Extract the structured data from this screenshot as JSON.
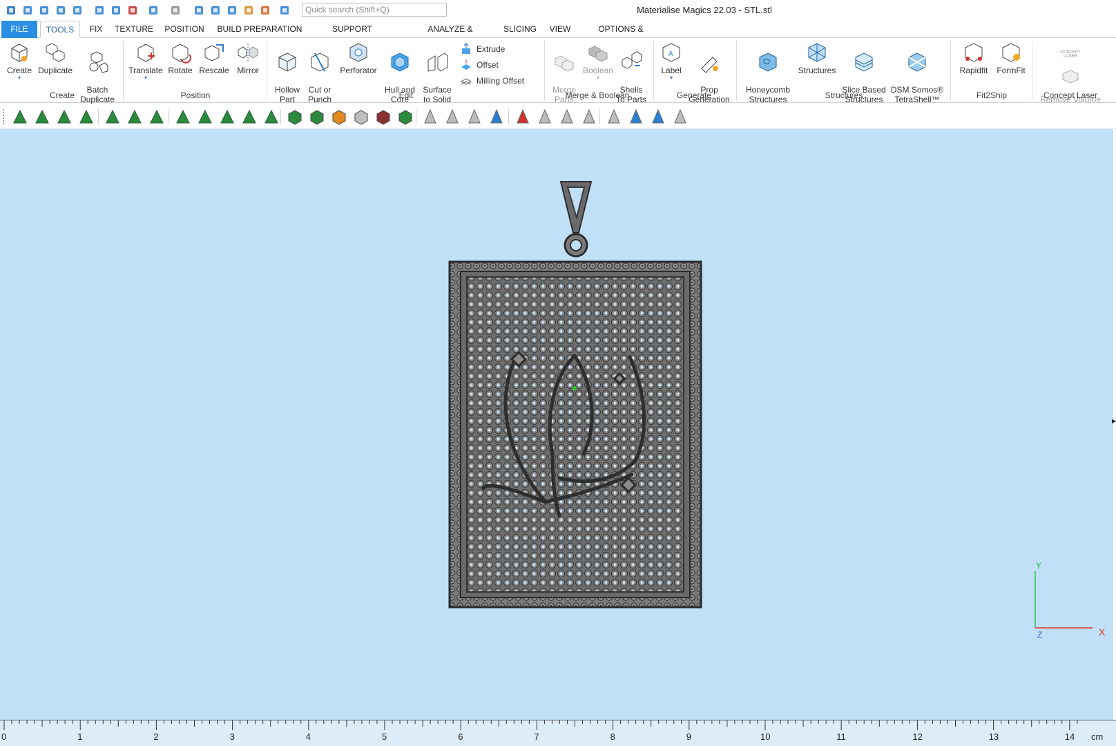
{
  "app": {
    "title": "Materialise Magics 22.03 - STL.stl",
    "search_placeholder": "Quick search (Shift+Q)"
  },
  "quick_access": [
    {
      "name": "app-logo-icon"
    },
    {
      "name": "new-icon"
    },
    {
      "name": "open-icon"
    },
    {
      "name": "save-icon"
    },
    {
      "name": "save-all-icon"
    },
    {
      "name": "import-icon"
    },
    {
      "name": "save-as-icon"
    },
    {
      "name": "close-part-icon"
    },
    {
      "name": "undo-icon"
    },
    {
      "name": "redo-icon"
    },
    {
      "name": "select-icon"
    },
    {
      "name": "zoom-region-icon"
    },
    {
      "name": "view-part-icon"
    },
    {
      "name": "zoom-icon"
    },
    {
      "name": "zoom-fit-icon"
    },
    {
      "name": "settings-icon"
    }
  ],
  "tabs": [
    "FILE",
    "TOOLS",
    "FIX",
    "TEXTURE",
    "POSITION",
    "BUILD PREPARATION",
    "SUPPORT GENERATION",
    "ANALYZE & REPORT",
    "SLICING",
    "VIEW",
    "OPTIONS & HELP"
  ],
  "active_tab": "TOOLS",
  "ribbon": {
    "create_group": {
      "label": "Create",
      "buttons": [
        "Create",
        "Duplicate",
        "Batch\nDuplicate"
      ]
    },
    "position_group": {
      "label": "Position",
      "buttons": [
        "Translate",
        "Rotate",
        "Rescale",
        "Mirror"
      ]
    },
    "edit_group": {
      "label": "Edit",
      "buttons": [
        "Hollow\nPart",
        "Cut or\nPunch",
        "Perforator",
        "Hull and\nCore",
        "Surface\nto Solid"
      ],
      "small": [
        "Extrude",
        "Offset",
        "Milling Offset"
      ]
    },
    "merge_group": {
      "label": "Merge & Boolean",
      "buttons": [
        "Merge\nParts",
        "Boolean",
        "Shells\nTo Parts"
      ]
    },
    "generate_group": {
      "label": "Generate",
      "buttons": [
        "Label",
        "Prop\nGeneration"
      ]
    },
    "structures_group": {
      "label": "Structures",
      "buttons": [
        "Honeycomb\nStructures",
        "Structures",
        "Slice Based\nStructures",
        "DSM Somos®\nTetraShell™"
      ]
    },
    "fit2ship_group": {
      "label": "Fit2Ship",
      "buttons": [
        "Rapidfit",
        "FormFit"
      ]
    },
    "concept_group": {
      "label": "Concept Laser",
      "buttons": [
        "Remove Volume\nWizard"
      ],
      "badge": "CONCEPT\nLASER"
    }
  },
  "axes": {
    "y": "Y",
    "x": "X",
    "z": "Z"
  },
  "ruler": {
    "unit": "cm",
    "labels": [
      "0",
      "1",
      "2",
      "3",
      "4",
      "5",
      "6",
      "7",
      "8",
      "9",
      "10",
      "11",
      "12",
      "13",
      "14"
    ]
  },
  "colors": {
    "viewport": "#c0e0f8",
    "accent": "#2a8fe3",
    "part": "#6b6b6b"
  }
}
